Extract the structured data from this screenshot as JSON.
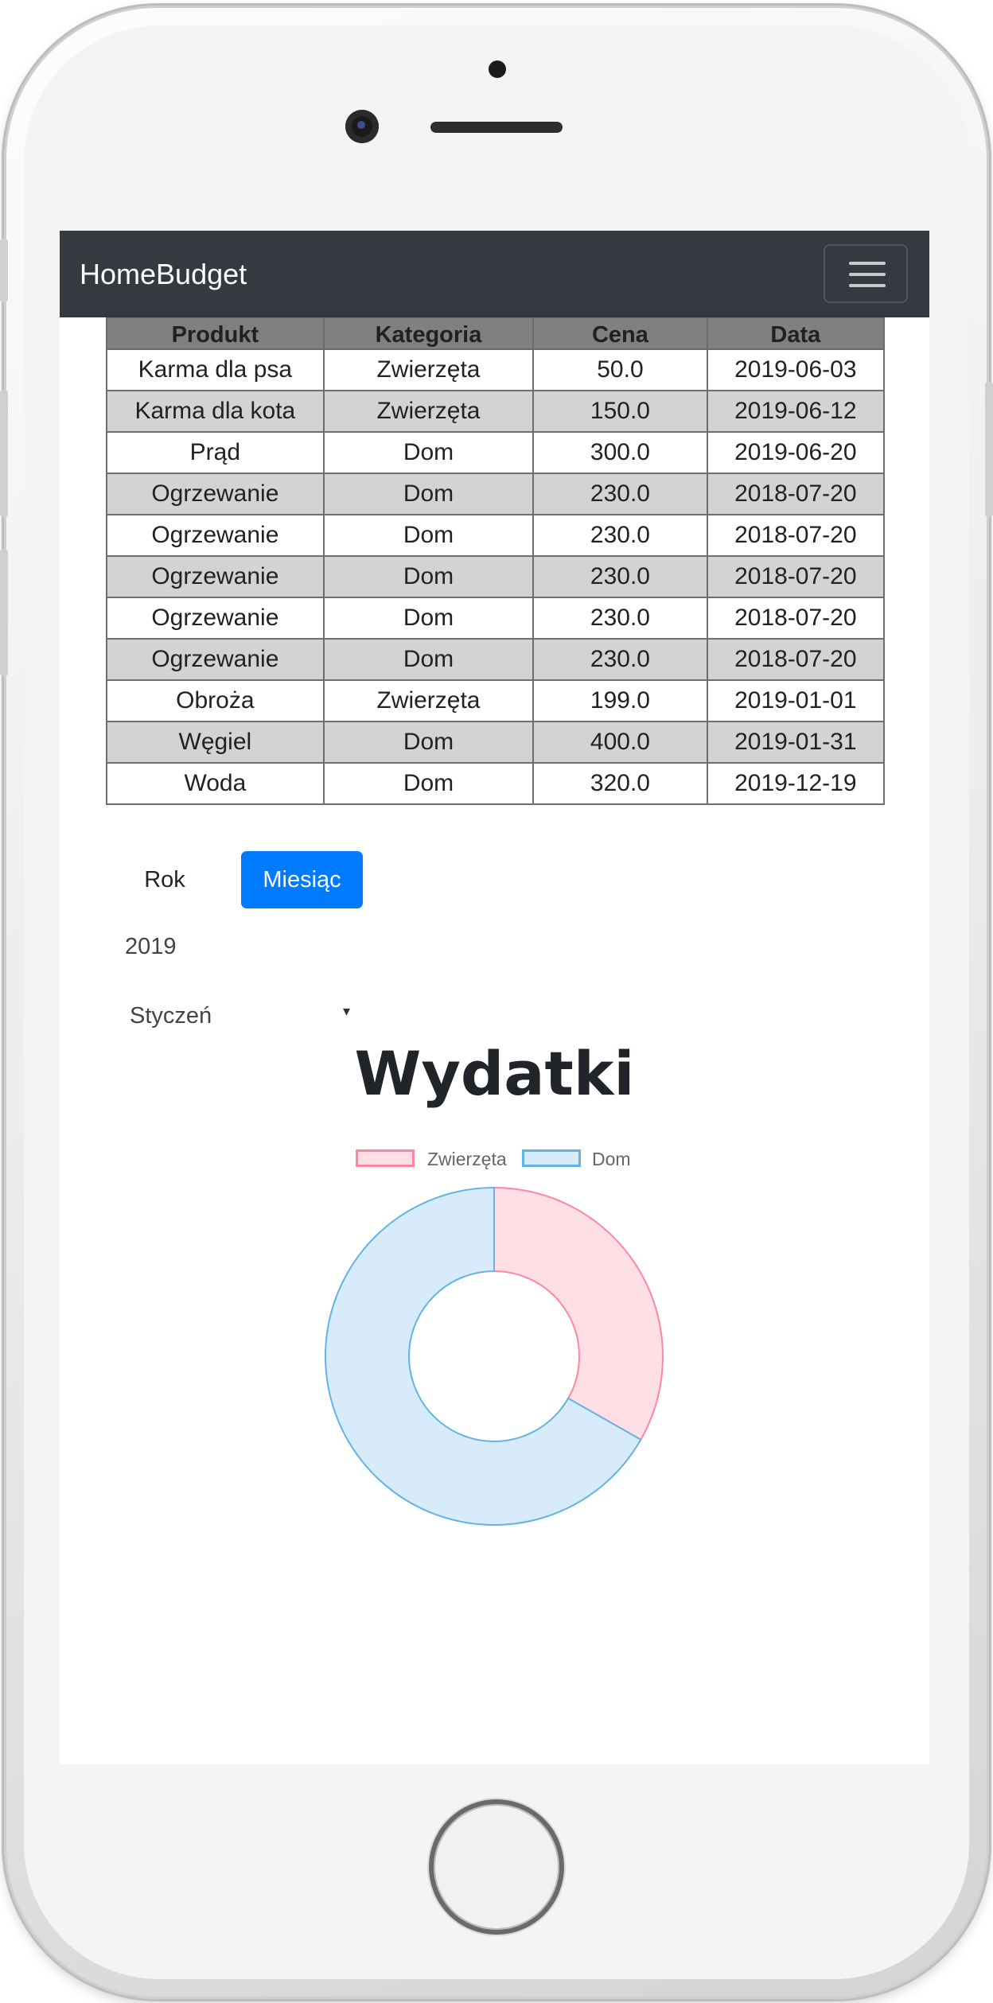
{
  "navbar": {
    "brand": "HomeBudget"
  },
  "table": {
    "headers": [
      "Produkt",
      "Kategoria",
      "Cena",
      "Data"
    ],
    "rows": [
      [
        "Karma dla psa",
        "Zwierzęta",
        "50.0",
        "2019-06-03"
      ],
      [
        "Karma dla kota",
        "Zwierzęta",
        "150.0",
        "2019-06-12"
      ],
      [
        "Prąd",
        "Dom",
        "300.0",
        "2019-06-20"
      ],
      [
        "Ogrzewanie",
        "Dom",
        "230.0",
        "2018-07-20"
      ],
      [
        "Ogrzewanie",
        "Dom",
        "230.0",
        "2018-07-20"
      ],
      [
        "Ogrzewanie",
        "Dom",
        "230.0",
        "2018-07-20"
      ],
      [
        "Ogrzewanie",
        "Dom",
        "230.0",
        "2018-07-20"
      ],
      [
        "Ogrzewanie",
        "Dom",
        "230.0",
        "2018-07-20"
      ],
      [
        "Obroża",
        "Zwierzęta",
        "199.0",
        "2019-01-01"
      ],
      [
        "Węgiel",
        "Dom",
        "400.0",
        "2019-01-31"
      ],
      [
        "Woda",
        "Dom",
        "320.0",
        "2019-12-19"
      ]
    ]
  },
  "controls": {
    "year_button": "Rok",
    "month_button": "Miesiąc",
    "year_value": "2019",
    "month_selected": "Styczeń",
    "accent_color": "#007bff"
  },
  "chart_data": {
    "type": "pie",
    "title": "Wydatki",
    "categories": [
      "Zwierzęta",
      "Dom"
    ],
    "values": [
      199,
      400
    ],
    "colors": {
      "Zwierzęta": {
        "fill": "#ffdfe5",
        "stroke": "#ff86a0"
      },
      "Dom": {
        "fill": "#d7ebfa",
        "stroke": "#62b3e6"
      }
    },
    "legend_placement": "top"
  }
}
